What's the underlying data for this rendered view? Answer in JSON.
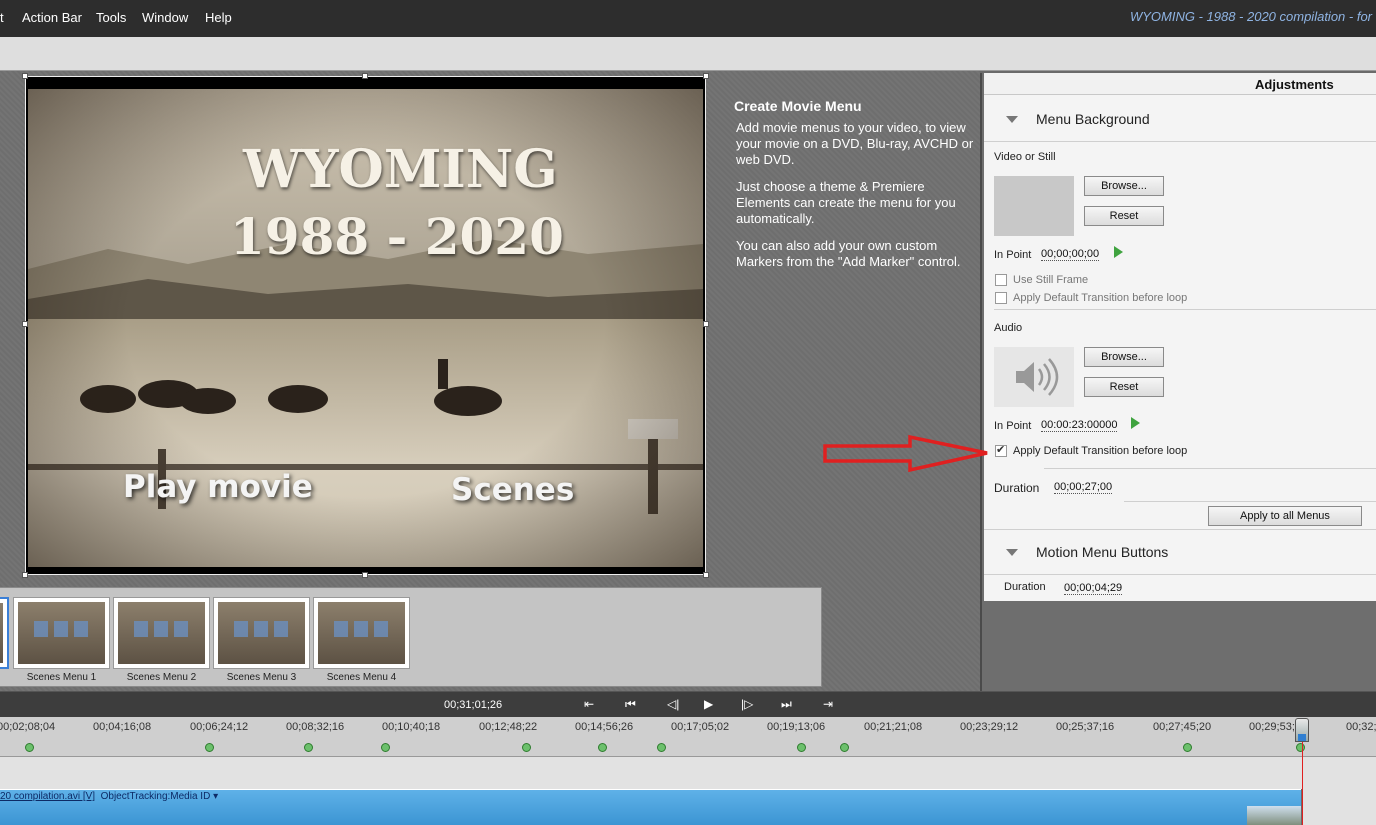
{
  "menubar": {
    "items": [
      "t",
      "Action Bar",
      "Tools",
      "Window",
      "Help"
    ],
    "window_title": "WYOMING - 1988 - 2020 compilation - for"
  },
  "preview": {
    "title_line1": "WYOMING",
    "title_line2": "1988 - 2020",
    "play_button": "Play movie",
    "scenes_button": "Scenes"
  },
  "info": {
    "heading": "Create Movie Menu",
    "paragraphs": [
      "Add movie menus to your video, to view your movie on a DVD, Blu-ray, AVCHD or web DVD.",
      "Just choose a theme & Premiere Elements can create the menu for you automatically.",
      "You can also add your own custom Markers from the \"Add Marker\" control."
    ]
  },
  "scenes": {
    "labels": [
      "Scenes Menu 1",
      "Scenes Menu 2",
      "Scenes Menu 3",
      "Scenes Menu 4"
    ]
  },
  "adjustments": {
    "header": "Adjustments",
    "menu_background": {
      "title": "Menu Background",
      "video_label": "Video or Still",
      "browse": "Browse...",
      "reset": "Reset",
      "in_point_label": "In Point",
      "in_point_value": "00;00;00;00",
      "use_still_frame": "Use Still Frame",
      "apply_transition_video": "Apply Default Transition before loop",
      "audio_label": "Audio",
      "audio_browse": "Browse...",
      "audio_reset": "Reset",
      "audio_in_point_label": "In Point",
      "audio_in_point_value": "00:00:23:00000",
      "apply_transition_audio": "Apply Default Transition before loop",
      "duration_label": "Duration",
      "duration_value": "00;00;27;00",
      "apply_all": "Apply to all Menus"
    },
    "motion_buttons": {
      "title": "Motion Menu Buttons",
      "duration_label": "Duration",
      "duration_value": "00;00;04;29"
    }
  },
  "timeline": {
    "timecode": "00;31;01;26",
    "ticks": [
      "00;02;08;04",
      "00;04;16;08",
      "00;06;24;12",
      "00;08;32;16",
      "00;10;40;18",
      "00;12;48;22",
      "00;14;56;26",
      "00;17;05;02",
      "00;19;13;06",
      "00;21;21;08",
      "00;23;29;12",
      "00;25;37;16",
      "00;27;45;20",
      "00;29;53;2",
      "00;32;0"
    ],
    "clip_name": "20 compilation.avi [V]",
    "clip_effect": "ObjectTracking:Media ID ▾"
  },
  "colors": {
    "accent_arrow": "#e02020",
    "clip_blue": "#4aa3e0",
    "marker_green": "#6cc06c"
  }
}
